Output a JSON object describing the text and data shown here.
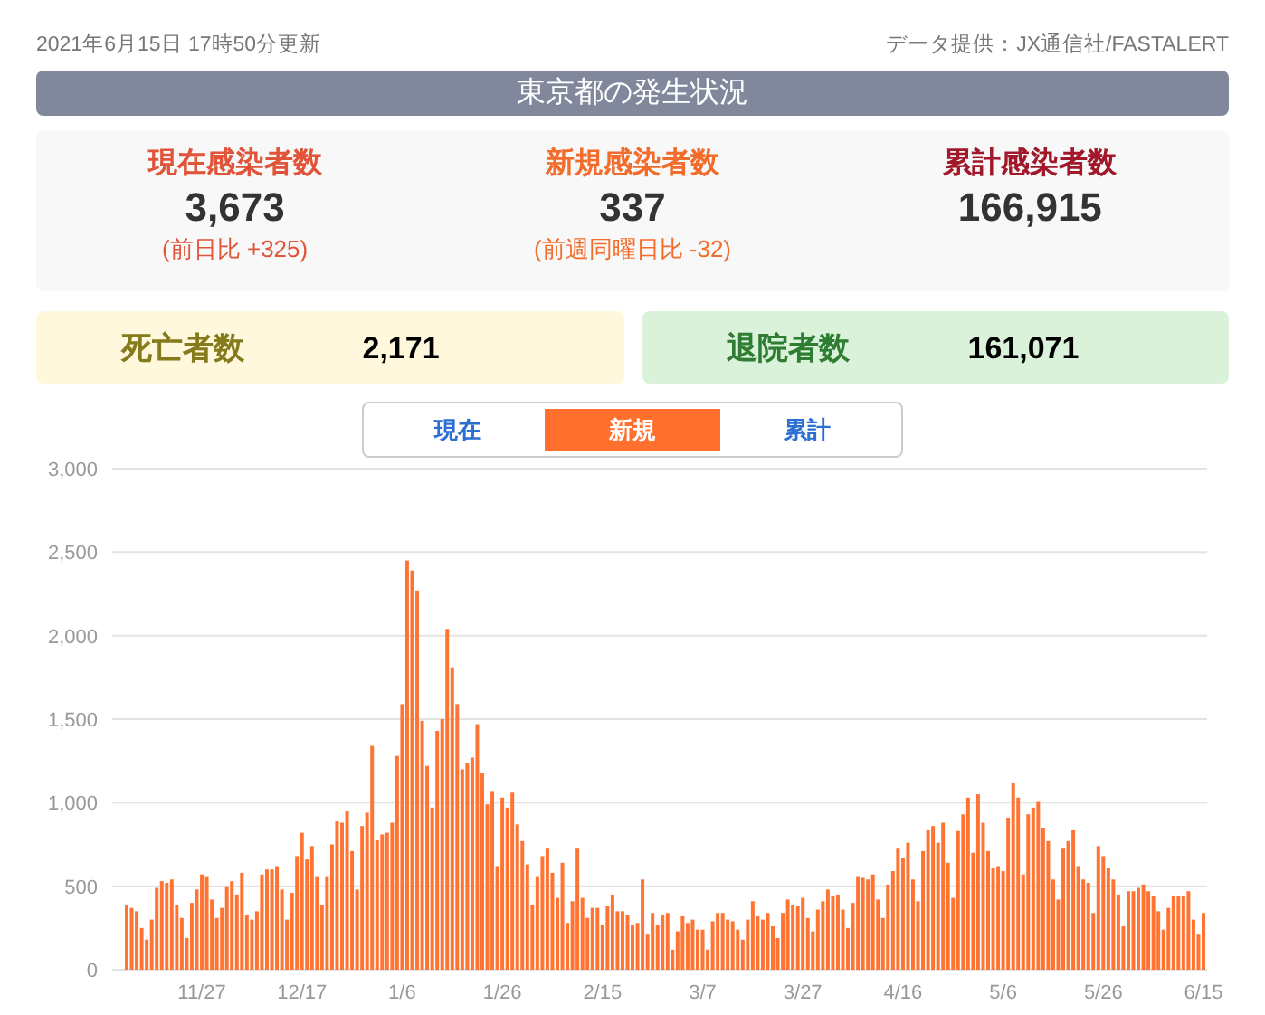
{
  "header": {
    "updated": "2021年6月15日 17時50分更新",
    "source": "データ提供：JX通信社/FASTALERT"
  },
  "title": "東京都の発生状況",
  "stats": [
    {
      "label": "現在感染者数",
      "value": "3,673",
      "note": "(前日比 +325)",
      "color": "#e0553a"
    },
    {
      "label": "新規感染者数",
      "value": "337",
      "note": "(前週同曜日比 -32)",
      "color": "#f26d2b"
    },
    {
      "label": "累計感染者数",
      "value": "166,915",
      "color": "#a0182a"
    }
  ],
  "totals": [
    {
      "label": "死亡者数",
      "value": "2,171",
      "kind": "deaths"
    },
    {
      "label": "退院者数",
      "value": "161,071",
      "kind": "discharged"
    }
  ],
  "tabs": [
    {
      "label": "現在",
      "selected": false
    },
    {
      "label": "新規",
      "selected": true
    },
    {
      "label": "累計",
      "selected": false
    }
  ],
  "chart_data": {
    "type": "bar",
    "grid": true,
    "categories": [
      null,
      null,
      null,
      null,
      null,
      null,
      null,
      null,
      null,
      null,
      null,
      null,
      null,
      null,
      null,
      "11/27",
      null,
      null,
      null,
      null,
      null,
      null,
      null,
      null,
      null,
      null,
      null,
      null,
      null,
      null,
      null,
      null,
      null,
      null,
      null,
      "12/17",
      null,
      null,
      null,
      null,
      null,
      null,
      null,
      null,
      null,
      null,
      null,
      null,
      null,
      null,
      null,
      null,
      null,
      null,
      null,
      "1/6",
      null,
      null,
      null,
      null,
      null,
      null,
      null,
      null,
      null,
      null,
      null,
      null,
      null,
      null,
      null,
      null,
      null,
      null,
      null,
      "1/26",
      null,
      null,
      null,
      null,
      null,
      null,
      null,
      null,
      null,
      null,
      null,
      null,
      null,
      null,
      null,
      null,
      null,
      null,
      null,
      "2/15",
      null,
      null,
      null,
      null,
      null,
      null,
      null,
      null,
      null,
      null,
      null,
      null,
      null,
      null,
      null,
      null,
      null,
      null,
      null,
      "3/7",
      null,
      null,
      null,
      null,
      null,
      null,
      null,
      null,
      null,
      null,
      null,
      null,
      null,
      null,
      null,
      null,
      null,
      null,
      null,
      "3/27",
      null,
      null,
      null,
      null,
      null,
      null,
      null,
      null,
      null,
      null,
      null,
      null,
      null,
      null,
      null,
      null,
      null,
      null,
      null,
      "4/16",
      null,
      null,
      null,
      null,
      null,
      null,
      null,
      null,
      null,
      null,
      null,
      null,
      null,
      null,
      null,
      null,
      null,
      null,
      null,
      "5/6",
      null,
      null,
      null,
      null,
      null,
      null,
      null,
      null,
      null,
      null,
      null,
      null,
      null,
      null,
      null,
      null,
      null,
      null,
      null,
      "5/26",
      null,
      null,
      null,
      null,
      null,
      null,
      null,
      null,
      null,
      null,
      null,
      null,
      null,
      null,
      null,
      null,
      null,
      null,
      null,
      "6/15"
    ],
    "series": [
      {
        "color": "#ff7433",
        "values": [
          390,
          370,
          350,
          250,
          180,
          300,
          490,
          530,
          520,
          540,
          390,
          310,
          190,
          400,
          480,
          570,
          560,
          420,
          310,
          370,
          500,
          530,
          450,
          580,
          330,
          300,
          350,
          570,
          600,
          600,
          620,
          480,
          300,
          460,
          680,
          820,
          660,
          740,
          560,
          390,
          560,
          750,
          890,
          880,
          950,
          710,
          480,
          860,
          940,
          1340,
          780,
          810,
          820,
          880,
          1280,
          1590,
          2450,
          2390,
          2270,
          1490,
          1220,
          970,
          1430,
          1500,
          2040,
          1810,
          1590,
          1200,
          1240,
          1270,
          1470,
          1180,
          990,
          1070,
          620,
          1030,
          970,
          1060,
          870,
          770,
          630,
          390,
          560,
          680,
          730,
          580,
          430,
          640,
          280,
          410,
          730,
          430,
          310,
          370,
          370,
          270,
          380,
          450,
          350,
          350,
          330,
          270,
          280,
          540,
          210,
          340,
          270,
          330,
          340,
          120,
          230,
          320,
          280,
          300,
          240,
          240,
          120,
          290,
          340,
          340,
          300,
          290,
          240,
          180,
          300,
          410,
          320,
          300,
          340,
          260,
          190,
          340,
          420,
          390,
          380,
          430,
          310,
          230,
          360,
          410,
          480,
          440,
          450,
          360,
          250,
          400,
          560,
          550,
          540,
          570,
          420,
          310,
          510,
          590,
          730,
          670,
          760,
          540,
          410,
          710,
          840,
          860,
          760,
          880,
          640,
          430,
          830,
          930,
          1030,
          700,
          1050,
          880,
          710,
          610,
          620,
          590,
          910,
          1120,
          1030,
          570,
          930,
          970,
          1010,
          850,
          770,
          540,
          420,
          730,
          770,
          840,
          620,
          540,
          520,
          340,
          740,
          680,
          610,
          540,
          450,
          260,
          470,
          470,
          490,
          510,
          470,
          440,
          350,
          240,
          370,
          440,
          440,
          440,
          470,
          300,
          210,
          340
        ]
      }
    ],
    "ylim": [
      0,
      3000
    ],
    "yticks": [
      {
        "value": 0,
        "label": "0"
      },
      {
        "value": 500,
        "label": "500"
      },
      {
        "value": 1000,
        "label": "1,000"
      },
      {
        "value": 1500,
        "label": "1,500"
      },
      {
        "value": 2000,
        "label": "2,000"
      },
      {
        "value": 2500,
        "label": "2,500"
      },
      {
        "value": 3000,
        "label": "3,000"
      }
    ]
  }
}
